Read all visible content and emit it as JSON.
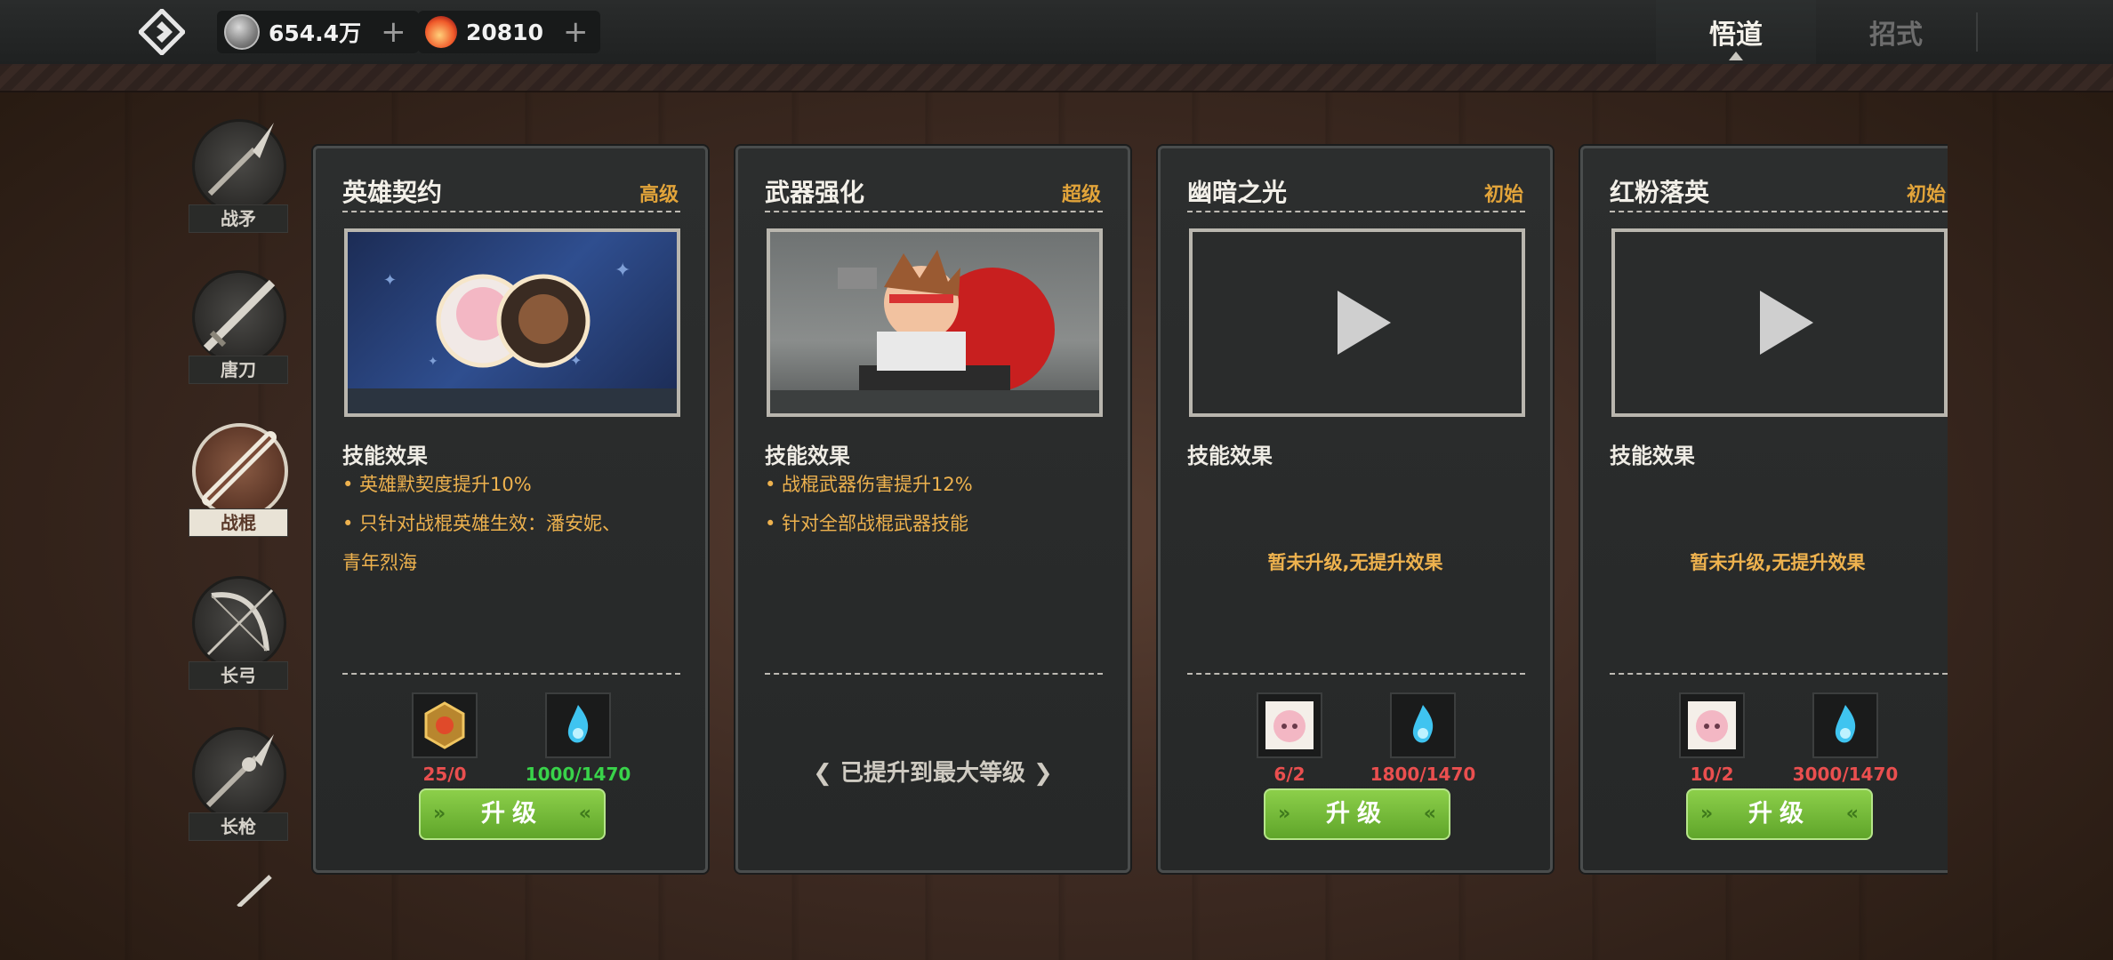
{
  "topbar": {
    "silver": {
      "value": "654.4万",
      "plus": "+"
    },
    "crystal": {
      "value": "20810",
      "plus": "+"
    },
    "tabs": [
      {
        "label": "悟道",
        "active": true
      },
      {
        "label": "招式",
        "active": false
      }
    ]
  },
  "sidebar": {
    "weapons": [
      {
        "label": "战矛",
        "active": false
      },
      {
        "label": "唐刀",
        "active": false
      },
      {
        "label": "战棍",
        "active": true
      },
      {
        "label": "长弓",
        "active": false
      },
      {
        "label": "长枪",
        "active": false
      }
    ]
  },
  "cards": [
    {
      "title": "英雄契约",
      "grade": "高级",
      "skill_header": "技能效果",
      "effects": [
        "• 英雄默契度提升10%",
        "• 只针对战棍英雄生效：潘安妮、",
        "青年烈海"
      ],
      "materials": [
        {
          "icon": "gold-medal-icon",
          "count": "25/0",
          "color": "red"
        },
        {
          "icon": "blue-soul-flame-icon",
          "count": "1000/1470",
          "color": "green"
        }
      ],
      "button": "升级"
    },
    {
      "title": "武器强化",
      "grade": "超级",
      "skill_header": "技能效果",
      "effects": [
        "• 战棍武器伤害提升12%",
        "• 针对全部战棍武器技能"
      ],
      "max_text": "已提升到最大等级"
    },
    {
      "title": "幽暗之光",
      "grade": "初始",
      "skill_header": "技能效果",
      "no_effect": "暂未升级,无提升效果",
      "materials": [
        {
          "icon": "hero-shard-icon",
          "count": "6/2",
          "color": "red"
        },
        {
          "icon": "blue-soul-flame-icon",
          "count": "1800/1470",
          "color": "red"
        }
      ],
      "button": "升级"
    },
    {
      "title": "红粉落英",
      "grade": "初始",
      "skill_header": "技能效果",
      "no_effect": "暂未升级,无提升效果",
      "materials": [
        {
          "icon": "hero-shard-icon",
          "count": "10/2",
          "color": "red"
        },
        {
          "icon": "blue-soul-flame-icon",
          "count": "3000/1470",
          "color": "red"
        }
      ],
      "button": "升级"
    }
  ]
}
